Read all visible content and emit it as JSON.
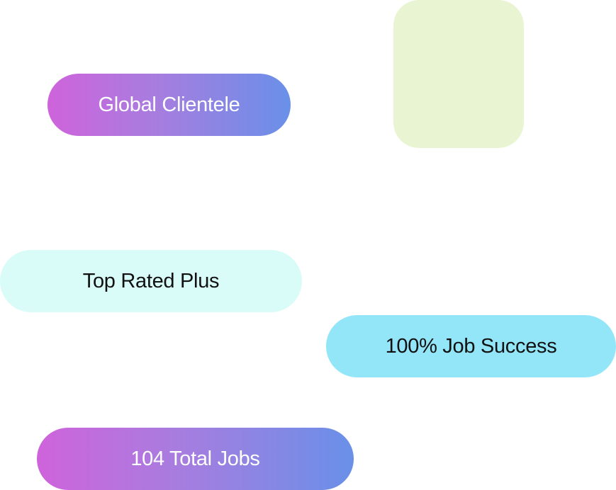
{
  "badges": {
    "global_clientele": "Global Clientele",
    "top_rated_plus": "Top Rated Plus",
    "job_success": "100% Job Success",
    "total_jobs": "104 Total Jobs"
  },
  "colors": {
    "gradient_start": "#cf63dc",
    "gradient_end": "#6990e8",
    "top_rated_bg": "#d9fcf8",
    "job_success_bg": "#93e6f8",
    "card_bg": "#e9f5d2"
  }
}
